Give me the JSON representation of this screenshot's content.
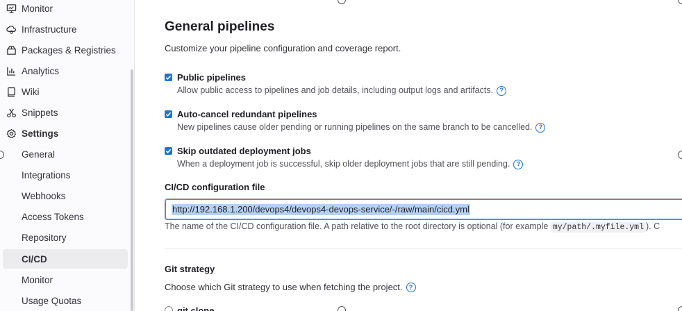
{
  "sidebar": {
    "top_items": [
      {
        "label": "Monitor",
        "icon": "monitor-icon"
      },
      {
        "label": "Infrastructure",
        "icon": "cloud-gear-icon"
      },
      {
        "label": "Packages & Registries",
        "icon": "package-icon"
      },
      {
        "label": "Analytics",
        "icon": "chart-icon"
      },
      {
        "label": "Wiki",
        "icon": "book-icon"
      },
      {
        "label": "Snippets",
        "icon": "scissors-icon"
      },
      {
        "label": "Settings",
        "icon": "settings-icon"
      }
    ],
    "settings_items": [
      {
        "label": "General"
      },
      {
        "label": "Integrations"
      },
      {
        "label": "Webhooks"
      },
      {
        "label": "Access Tokens"
      },
      {
        "label": "Repository"
      },
      {
        "label": "CI/CD",
        "active": true
      },
      {
        "label": "Monitor"
      },
      {
        "label": "Usage Quotas"
      }
    ]
  },
  "main": {
    "title": "General pipelines",
    "description": "Customize your pipeline configuration and coverage report.",
    "options": [
      {
        "title": "Public pipelines",
        "help": "Allow public access to pipelines and job details, including output logs and artifacts.",
        "checked": true
      },
      {
        "title": "Auto-cancel redundant pipelines",
        "help": "New pipelines cause older pending or running pipelines on the same branch to be cancelled.",
        "checked": true
      },
      {
        "title": "Skip outdated deployment jobs",
        "help": "When a deployment job is successful, skip older deployment jobs that are still pending.",
        "checked": true
      }
    ],
    "cicd_file": {
      "label": "CI/CD configuration file",
      "value": "http://192.168.1.200/devops4/devops4-devops-service/-/raw/main/cicd.yml",
      "help_prefix": "The name of the CI/CD configuration file. A path relative to the root directory is optional (for example ",
      "help_code": "my/path/.myfile.yml",
      "help_suffix": "). C"
    },
    "git_strategy": {
      "title": "Git strategy",
      "description": "Choose which Git strategy to use when fetching the project.",
      "first_option": "git clone"
    },
    "help_glyph": "?",
    "accent_color": "#1f75cb"
  }
}
